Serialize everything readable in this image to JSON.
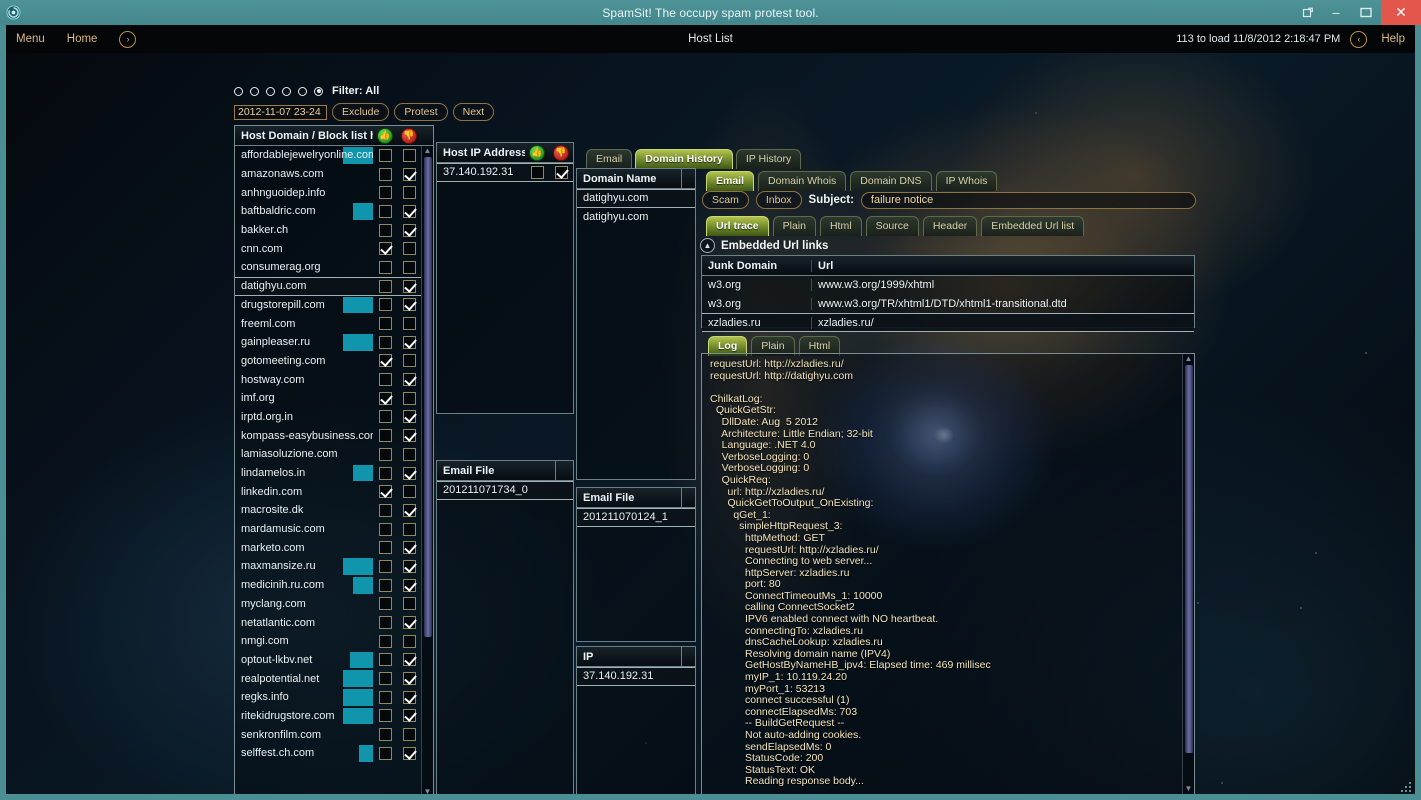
{
  "window": {
    "title": "SpamSit! The occupy spam protest tool.",
    "app_icon": "spiral-icon",
    "buttons": {
      "restore_down": "restore-icon",
      "minimize": "–",
      "maximize": "❐",
      "close": "✕"
    }
  },
  "menubar": {
    "menu": "Menu",
    "home": "Home",
    "forward_icon": "›",
    "center_title": "Host List",
    "load_status": "113 to load 11/8/2012 2:18:47 PM",
    "back_icon": "‹",
    "help": "Help"
  },
  "filter": {
    "label": "Filter: All",
    "radios": [
      false,
      false,
      false,
      false,
      false,
      true
    ],
    "date_value": "2012-11-07 23-24",
    "exclude": "Exclude",
    "protest": "Protest",
    "next": "Next"
  },
  "host_list": {
    "header": "Host Domain / Block list hits",
    "action_allow_icon": "green-thumb-icon",
    "action_block_icon": "red-block-icon",
    "rows": [
      {
        "domain": "affordablejewelryonline.com",
        "hit": 30,
        "cb1": false,
        "cb2": false
      },
      {
        "domain": "amazonaws.com",
        "hit": 0,
        "cb1": false,
        "cb2": true
      },
      {
        "domain": "anhnguoidep.info",
        "hit": 0,
        "cb1": false,
        "cb2": false
      },
      {
        "domain": "baftbaldric.com",
        "hit": 20,
        "cb1": false,
        "cb2": true
      },
      {
        "domain": "bakker.ch",
        "hit": 0,
        "cb1": false,
        "cb2": true
      },
      {
        "domain": "cnn.com",
        "hit": 0,
        "cb1": true,
        "cb2": false
      },
      {
        "domain": "consumerag.org",
        "hit": 0,
        "cb1": false,
        "cb2": false
      },
      {
        "domain": "datighyu.com",
        "hit": 0,
        "cb1": false,
        "cb2": true,
        "selected": true
      },
      {
        "domain": "drugstorepill.com",
        "hit": 30,
        "cb1": false,
        "cb2": true
      },
      {
        "domain": "freeml.com",
        "hit": 0,
        "cb1": false,
        "cb2": false
      },
      {
        "domain": "gainpleaser.ru",
        "hit": 30,
        "cb1": false,
        "cb2": true
      },
      {
        "domain": "gotomeeting.com",
        "hit": 0,
        "cb1": true,
        "cb2": false
      },
      {
        "domain": "hostway.com",
        "hit": 0,
        "cb1": false,
        "cb2": true
      },
      {
        "domain": "imf.org",
        "hit": 0,
        "cb1": true,
        "cb2": false
      },
      {
        "domain": "irptd.org.in",
        "hit": 0,
        "cb1": false,
        "cb2": true
      },
      {
        "domain": "kompass-easybusiness.com",
        "hit": 0,
        "cb1": false,
        "cb2": true
      },
      {
        "domain": "lamiasoluzione.com",
        "hit": 0,
        "cb1": false,
        "cb2": false
      },
      {
        "domain": "lindamelos.in",
        "hit": 20,
        "cb1": false,
        "cb2": true
      },
      {
        "domain": "linkedin.com",
        "hit": 0,
        "cb1": true,
        "cb2": false
      },
      {
        "domain": "macrosite.dk",
        "hit": 0,
        "cb1": false,
        "cb2": true
      },
      {
        "domain": "mardamusic.com",
        "hit": 0,
        "cb1": false,
        "cb2": false
      },
      {
        "domain": "marketo.com",
        "hit": 0,
        "cb1": false,
        "cb2": true
      },
      {
        "domain": "maxmansize.ru",
        "hit": 30,
        "cb1": false,
        "cb2": true
      },
      {
        "domain": "medicinih.ru.com",
        "hit": 20,
        "cb1": false,
        "cb2": true
      },
      {
        "domain": "myclang.com",
        "hit": 0,
        "cb1": false,
        "cb2": false
      },
      {
        "domain": "netatlantic.com",
        "hit": 0,
        "cb1": false,
        "cb2": true
      },
      {
        "domain": "nmgi.com",
        "hit": 0,
        "cb1": false,
        "cb2": false
      },
      {
        "domain": "optout-lkbv.net",
        "hit": 23,
        "cb1": false,
        "cb2": true
      },
      {
        "domain": "realpotential.net",
        "hit": 30,
        "cb1": false,
        "cb2": true
      },
      {
        "domain": "regks.info",
        "hit": 30,
        "cb1": false,
        "cb2": true
      },
      {
        "domain": "ritekidrugstore.com",
        "hit": 30,
        "cb1": false,
        "cb2": true
      },
      {
        "domain": "senkronfilm.com",
        "hit": 0,
        "cb1": false,
        "cb2": false
      },
      {
        "domain": "selffest.ch.com",
        "hit": 14,
        "cb1": false,
        "cb2": true
      }
    ]
  },
  "host_ip": {
    "header": "Host IP Address",
    "action_allow_icon": "green-thumb-icon",
    "action_block_icon": "red-block-icon",
    "rows": [
      {
        "ip": "37.140.192.31",
        "cb1": false,
        "cb2": true,
        "selected": true
      }
    ]
  },
  "ip_email_file": {
    "header": "Email File",
    "rows": [
      {
        "file": "201211071734_0",
        "selected": true
      }
    ]
  },
  "history_tabs": [
    {
      "label": "Email",
      "active": false
    },
    {
      "label": "Domain History",
      "active": true
    },
    {
      "label": "IP History",
      "active": false
    }
  ],
  "domain_name": {
    "header": "Domain Name",
    "rows": [
      {
        "name": "datighyu.com",
        "selected": true
      },
      {
        "name": "datighyu.com",
        "selected": false
      }
    ]
  },
  "domain_email_file": {
    "header": "Email File",
    "rows": [
      {
        "file": "201211070124_1",
        "selected": true
      }
    ]
  },
  "domain_ip": {
    "header": "IP",
    "rows": [
      {
        "ip": "37.140.192.31",
        "selected": true
      }
    ]
  },
  "email_tabs": [
    {
      "label": "Email",
      "active": true
    },
    {
      "label": "Domain Whois",
      "active": false
    },
    {
      "label": "Domain DNS",
      "active": false
    },
    {
      "label": "IP Whois",
      "active": false
    }
  ],
  "email_header": {
    "scam": "Scam",
    "inbox": "Inbox",
    "subject_label": "Subject:",
    "subject_value": "failure notice"
  },
  "view_tabs": [
    {
      "label": "Url trace",
      "active": true
    },
    {
      "label": "Plain",
      "active": false
    },
    {
      "label": "Html",
      "active": false
    },
    {
      "label": "Source",
      "active": false
    },
    {
      "label": "Header",
      "active": false
    },
    {
      "label": "Embedded Url list",
      "active": false
    }
  ],
  "embedded": {
    "toggle_icon": "chevron-up-icon",
    "title": "Embedded Url links",
    "columns": [
      "Junk Domain",
      "Url"
    ],
    "rows": [
      {
        "junk_domain": "w3.org",
        "url": "www.w3.org/1999/xhtml",
        "selected": false
      },
      {
        "junk_domain": "w3.org",
        "url": "www.w3.org/TR/xhtml1/DTD/xhtml1-transitional.dtd",
        "selected": false
      },
      {
        "junk_domain": "xzladies.ru",
        "url": "xzladies.ru/",
        "selected": true
      }
    ]
  },
  "log_tabs": [
    {
      "label": "Log",
      "active": true
    },
    {
      "label": "Plain",
      "active": false
    },
    {
      "label": "Html",
      "active": false
    }
  ],
  "log_text": "requestUrl: http://xzladies.ru/\nrequestUrl: http://datighyu.com\n\nChilkatLog:\n  QuickGetStr:\n    DllDate: Aug  5 2012\n    Architecture: Little Endian; 32-bit\n    Language: .NET 4.0\n    VerboseLogging: 0\n    VerboseLogging: 0\n    QuickReq:\n      url: http://xzladies.ru/\n      QuickGetToOutput_OnExisting:\n        qGet_1:\n          simpleHttpRequest_3:\n            httpMethod: GET\n            requestUrl: http://xzladies.ru/\n            Connecting to web server...\n            httpServer: xzladies.ru\n            port: 80\n            ConnectTimeoutMs_1: 10000\n            calling ConnectSocket2\n            IPV6 enabled connect with NO heartbeat.\n            connectingTo: xzladies.ru\n            dnsCacheLookup: xzladies.ru\n            Resolving domain name (IPV4)\n            GetHostByNameHB_ipv4: Elapsed time: 469 millisec\n            myIP_1: 10.119.24.20\n            myPort_1: 53213\n            connect successful (1)\n            connectElapsedMs: 703\n            -- BuildGetRequest --\n            Not auto-adding cookies.\n            sendElapsedMs: 0\n            StatusCode: 200\n            StatusText: OK\n            Reading response body...",
  "colors": {
    "accent_teal": "#4b8f94",
    "hit_bar": "#1195ac",
    "tab_active": "#8fae36",
    "gold_text": "#d9b97e",
    "close_red": "#e2564c"
  }
}
